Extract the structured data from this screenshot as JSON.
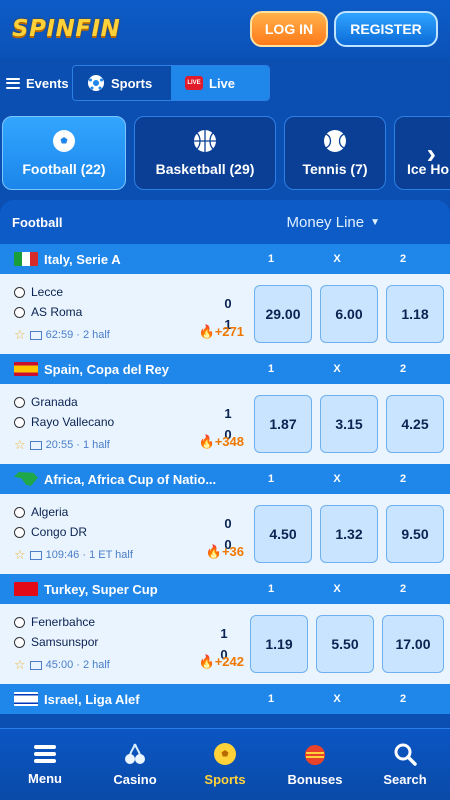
{
  "brand": "SPINFIN",
  "header": {
    "login": "LOG IN",
    "register": "REGISTER"
  },
  "eventbar": {
    "events": "Events",
    "sports": "Sports",
    "live": "Live",
    "live_badge": "LIVE"
  },
  "sport_tabs": [
    {
      "label": "Football (22)",
      "active": true
    },
    {
      "label": "Basketball (29)",
      "active": false
    },
    {
      "label": "Tennis (7)",
      "active": false
    },
    {
      "label": "Ice Ho",
      "active": false
    }
  ],
  "panel": {
    "title": "Football",
    "market": "Money Line"
  },
  "cols": [
    "1",
    "X",
    "2"
  ],
  "leagues": [
    {
      "name": "Italy, Serie A",
      "match": {
        "home": "Lecce",
        "away": "AS Roma",
        "home_score": "0",
        "away_score": "1",
        "time": "62:59 · 2 half",
        "more": "+271",
        "odds": [
          "29.00",
          "6.00",
          "1.18"
        ]
      }
    },
    {
      "name": "Spain, Copa del Rey",
      "match": {
        "home": "Granada",
        "away": "Rayo Vallecano",
        "home_score": "1",
        "away_score": "0",
        "time": "20:55 · 1 half",
        "more": "+348",
        "odds": [
          "1.87",
          "3.15",
          "4.25"
        ]
      }
    },
    {
      "name": "Africa, Africa Cup of Natio...",
      "match": {
        "home": "Algeria",
        "away": "Congo DR",
        "home_score": "0",
        "away_score": "0",
        "time": "109:46 · 1 ET half",
        "more": "+36",
        "odds": [
          "4.50",
          "1.32",
          "9.50"
        ]
      }
    },
    {
      "name": "Turkey, Super Cup",
      "match": {
        "home": "Fenerbahce",
        "away": "Samsunspor",
        "home_score": "1",
        "away_score": "0",
        "time": "45:00 · 2 half",
        "more": "+242",
        "odds": [
          "1.19",
          "5.50",
          "17.00"
        ]
      }
    },
    {
      "name": "Israel, Liga Alef"
    }
  ],
  "bottom_nav": [
    {
      "label": "Menu",
      "icon": "menu-icon"
    },
    {
      "label": "Casino",
      "icon": "cherry-icon"
    },
    {
      "label": "Sports",
      "icon": "football-icon",
      "active": true
    },
    {
      "label": "Bonuses",
      "icon": "gift-ball-icon"
    },
    {
      "label": "Search",
      "icon": "search-icon"
    }
  ],
  "colors": {
    "bg": "#0b4fb2",
    "accent": "#1f86ea",
    "gold": "#ffd23a",
    "odd_bg": "#c8e4ff"
  }
}
